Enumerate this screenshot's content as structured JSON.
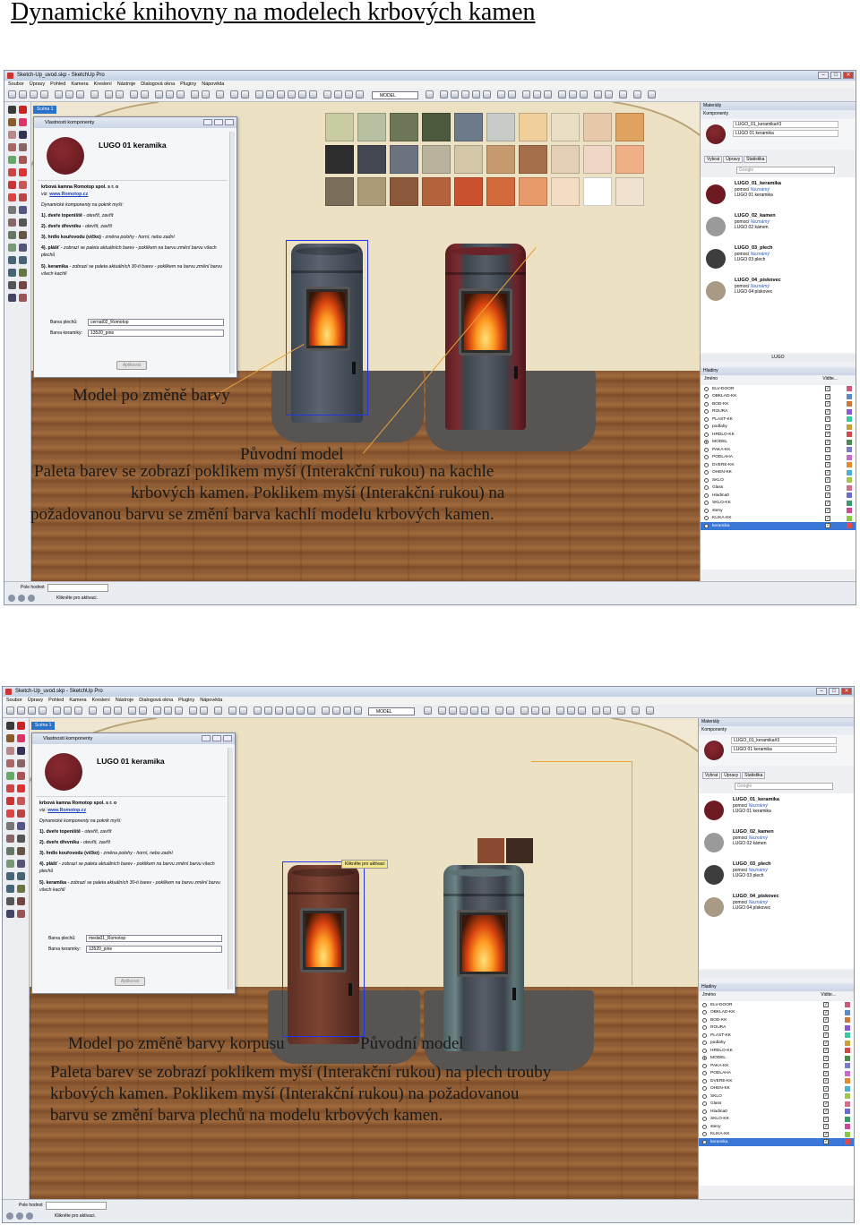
{
  "document": {
    "title": "Dynamické knihovny na modelech krbových kamen"
  },
  "colors": {
    "wireframe": "#2536e8",
    "accent": "#2a73c9",
    "leader_line": "#e7a23a"
  },
  "app_window": {
    "minimize": "–",
    "maximize": "□",
    "close": "✕"
  },
  "screenshots": [
    {
      "window_title": "Sketch-Up_uvod.skp - SketchUp Pro",
      "menu": [
        "Soubor",
        "Úpravy",
        "Pohled",
        "Kamera",
        "Kreslení",
        "Nástroje",
        "Dialogová okna",
        "Pluginy",
        "Nápověda"
      ],
      "toolbar": {
        "model_select": "MODEL"
      },
      "scene_tab": "Scéna 1",
      "component_window": {
        "title": "Vlastnosti komponenty",
        "component_name": "LUGO 01 keramika",
        "text": {
          "maker": "krbová kamna Romotop spol. s r. o",
          "web_prefix": "viz: ",
          "web": "www.Romotop.cz",
          "intro": "Dynamické komponenty na pokrik myší:",
          "item1_b": "1). dveře topeniště",
          "item1": " - otevřít, zavřít",
          "item2_b": "2). dveře dřevníku",
          "item2": " - otevřít, zavřít",
          "item3_b": "3). hrdlo kouřovodu (víčko)",
          "item3": " - změna polohy - horní, nebo zadní",
          "item4_b": "4). plášť",
          "item4": " - zobrazí se paleta aktuálních barev - poklikem na barvu změní barvu všech plechů",
          "item5_b": "5). keramika",
          "item5": " - zobrazí se paleta aktuálních 30-ti barev - poklikem na barvu změní barvu všech kachlí"
        },
        "fields": [
          {
            "label": "Barva plechů:",
            "value": "cernat02_Romotop"
          },
          {
            "label": "Barva keramiky:",
            "value": "13520_pine"
          }
        ],
        "apply": "Aplikovat"
      },
      "right_panel": {
        "materials_title": "Materiály",
        "components_title": "Komponenty",
        "selected_name": "LUGO_01_keramika#3",
        "selected_desc": "LUGO 01 keramika",
        "tabs": [
          "Vybrat",
          "Úpravy",
          "Statistika"
        ],
        "search_placeholder": "Google",
        "items": [
          {
            "name": "LUGO_01_keramika",
            "sub": "pomocí ",
            "sub_i": "Neznámý",
            "desc": "LUGO 01 keramika",
            "color": "#6e1a22"
          },
          {
            "name": "LUGO_02_kamen",
            "sub": "pomocí ",
            "sub_i": "Neznámý",
            "desc": "LUGO 02 kámen",
            "color": "#9a9a9a"
          },
          {
            "name": "LUGO_03_plech",
            "sub": "pomocí ",
            "sub_i": "Neznámý",
            "desc": "LUGO 03 plech",
            "color": "#3d3d3d"
          },
          {
            "name": "LUGO_04_piskovec",
            "sub": "pomocí ",
            "sub_i": "Neznámý",
            "desc": "LUGO 04 pískovec",
            "color": "#a89a84"
          }
        ],
        "footer_label": "LUGO",
        "layers_title": "Hladiny",
        "layers_header": {
          "name": "Jméno",
          "visible": "Vidite..."
        },
        "layers": [
          {
            "name": "ELV-DOOR",
            "color": "#c95a7a"
          },
          {
            "name": "OBKLAD-KK",
            "color": "#5a8ac8"
          },
          {
            "name": "BOD-KK",
            "color": "#c87a3a"
          },
          {
            "name": "ROURA",
            "color": "#8a5ac8"
          },
          {
            "name": "PLAST-KK",
            "color": "#3ac8a0"
          },
          {
            "name": "podlahy",
            "color": "#c8a03a"
          },
          {
            "name": "HRDLO-KK",
            "color": "#d04a4a"
          },
          {
            "name": "MODEL",
            "color": "#4a8a4a",
            "active": true
          },
          {
            "name": "PAKA-KK",
            "color": "#7a7ad0"
          },
          {
            "name": "PODLAHA",
            "color": "#c86ac8"
          },
          {
            "name": "DVERE-KK",
            "color": "#e08a30"
          },
          {
            "name": "OHEN-KK",
            "color": "#4ab0d0"
          },
          {
            "name": "SKLO",
            "color": "#a0c84a"
          },
          {
            "name": "Glass",
            "color": "#d86a8a"
          },
          {
            "name": "Hladina0",
            "color": "#6a6ad8"
          },
          {
            "name": "SKLO-KK",
            "color": "#3a9a6a"
          },
          {
            "name": "steny",
            "color": "#c84a9a"
          },
          {
            "name": "KLIKA-KK",
            "color": "#8ac84a"
          },
          {
            "name": "keramika",
            "color": "#e04a4a",
            "selected": true
          }
        ]
      },
      "status": {
        "field_label": "Pole hodnot",
        "hint": "Klikněte pro aktivaci."
      },
      "swatches": [
        "#c9cba2",
        "#b7c1a2",
        "#6d7757",
        "#4b5a3c",
        "#6d7a8a",
        "#c8ccc9",
        "#f1cf9b",
        "#eadfc5",
        "#e8c9ac",
        "#e0a35f",
        "#2d2d2d",
        "#43474f",
        "#6b7280",
        "#b9b39e",
        "#d4c7a8",
        "#c79a6f",
        "#a46e4a",
        "#e3cfb4",
        "#f0d6c4",
        "#efb088",
        "#7a6e5b",
        "#ab9a76",
        "#8c5a3a",
        "#b5633d",
        "#c9512f",
        "#d36a3c",
        "#e89a6a",
        "#f5ddc4",
        "#ffffff",
        "#f1e2d0"
      ],
      "captions": {
        "after": "Model po změně barvy",
        "original": "Původní model",
        "desc1": "Paleta barev se zobrazí poklikem myší (Interakční rukou) na kachle",
        "desc2": "krbových kamen. Poklikem myší (Interakční rukou) na",
        "desc3": "požadovanou barvu se změní barva kachlí modelu krbových kamen."
      }
    },
    {
      "window_title": "Sketch-Up_uvod.skp - SketchUp Pro",
      "menu": [
        "Soubor",
        "Úpravy",
        "Pohled",
        "Kamera",
        "Kreslení",
        "Nástroje",
        "Dialogová okna",
        "Pluginy",
        "Nápověda"
      ],
      "toolbar": {
        "model_select": "MODEL"
      },
      "scene_tab": "Scéna 1",
      "component_window": {
        "title": "Vlastnosti komponenty",
        "component_name": "LUGO 01 keramika",
        "fields": [
          {
            "label": "Barva plechů:",
            "value": "meda01_Romotop"
          },
          {
            "label": "Barva keramiky:",
            "value": "13520_pine"
          }
        ],
        "apply": "Aplikovat"
      },
      "right_panel": {
        "selected_name": "LUGO_01_keramika#3",
        "selected_desc": "LUGO 01 keramika"
      },
      "tooltip": "Klikněte pro aktivaci",
      "swatches": [
        "#8a4a30",
        "#3f2a22"
      ],
      "captions": {
        "after": "Model po změně barvy korpusu",
        "original": "Původní model",
        "desc1": "Paleta barev se zobrazí poklikem myší (Interakční rukou) na plech trouby",
        "desc2": "krbových kamen. Poklikem myší (Interakční rukou) na požadovanou",
        "desc3": "barvu se změní barva plechů na modelu krbových kamen."
      }
    }
  ]
}
